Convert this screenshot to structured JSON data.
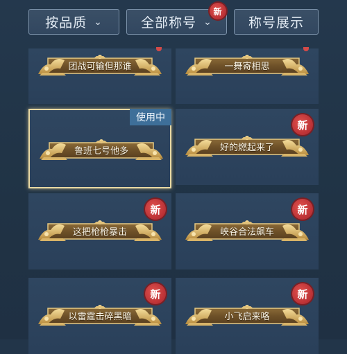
{
  "filters": {
    "quality": {
      "label": "按品质",
      "chevron": "⌄"
    },
    "all_titles": {
      "label": "全部称号",
      "chevron": "⌄",
      "new_badge": "新"
    },
    "showcase": {
      "label": "称号展示"
    }
  },
  "titles": [
    {
      "name": "团战可输但那谁",
      "new": "",
      "in_use": ""
    },
    {
      "name": "一舞寄相思",
      "new": "",
      "in_use": ""
    },
    {
      "name": "鲁班七号他多",
      "new": "",
      "in_use": "使用中"
    },
    {
      "name": "好的燃起来了",
      "new": "新",
      "in_use": ""
    },
    {
      "name": "这把枪枪暴击",
      "new": "新",
      "in_use": ""
    },
    {
      "name": "峡谷合法飙车",
      "new": "新",
      "in_use": ""
    },
    {
      "name": "以雷霆击碎黑暗",
      "new": "新",
      "in_use": ""
    },
    {
      "name": "小飞启来咯",
      "new": "新",
      "in_use": ""
    }
  ],
  "colors": {
    "background": "#223549",
    "card": "#2d4460",
    "banner_gold": "#c9a45a",
    "banner_brown": "#7a5a2e",
    "new_badge": "#c8343a",
    "in_use_tag": "#3e6f99",
    "active_border": "#e9d9a3"
  }
}
